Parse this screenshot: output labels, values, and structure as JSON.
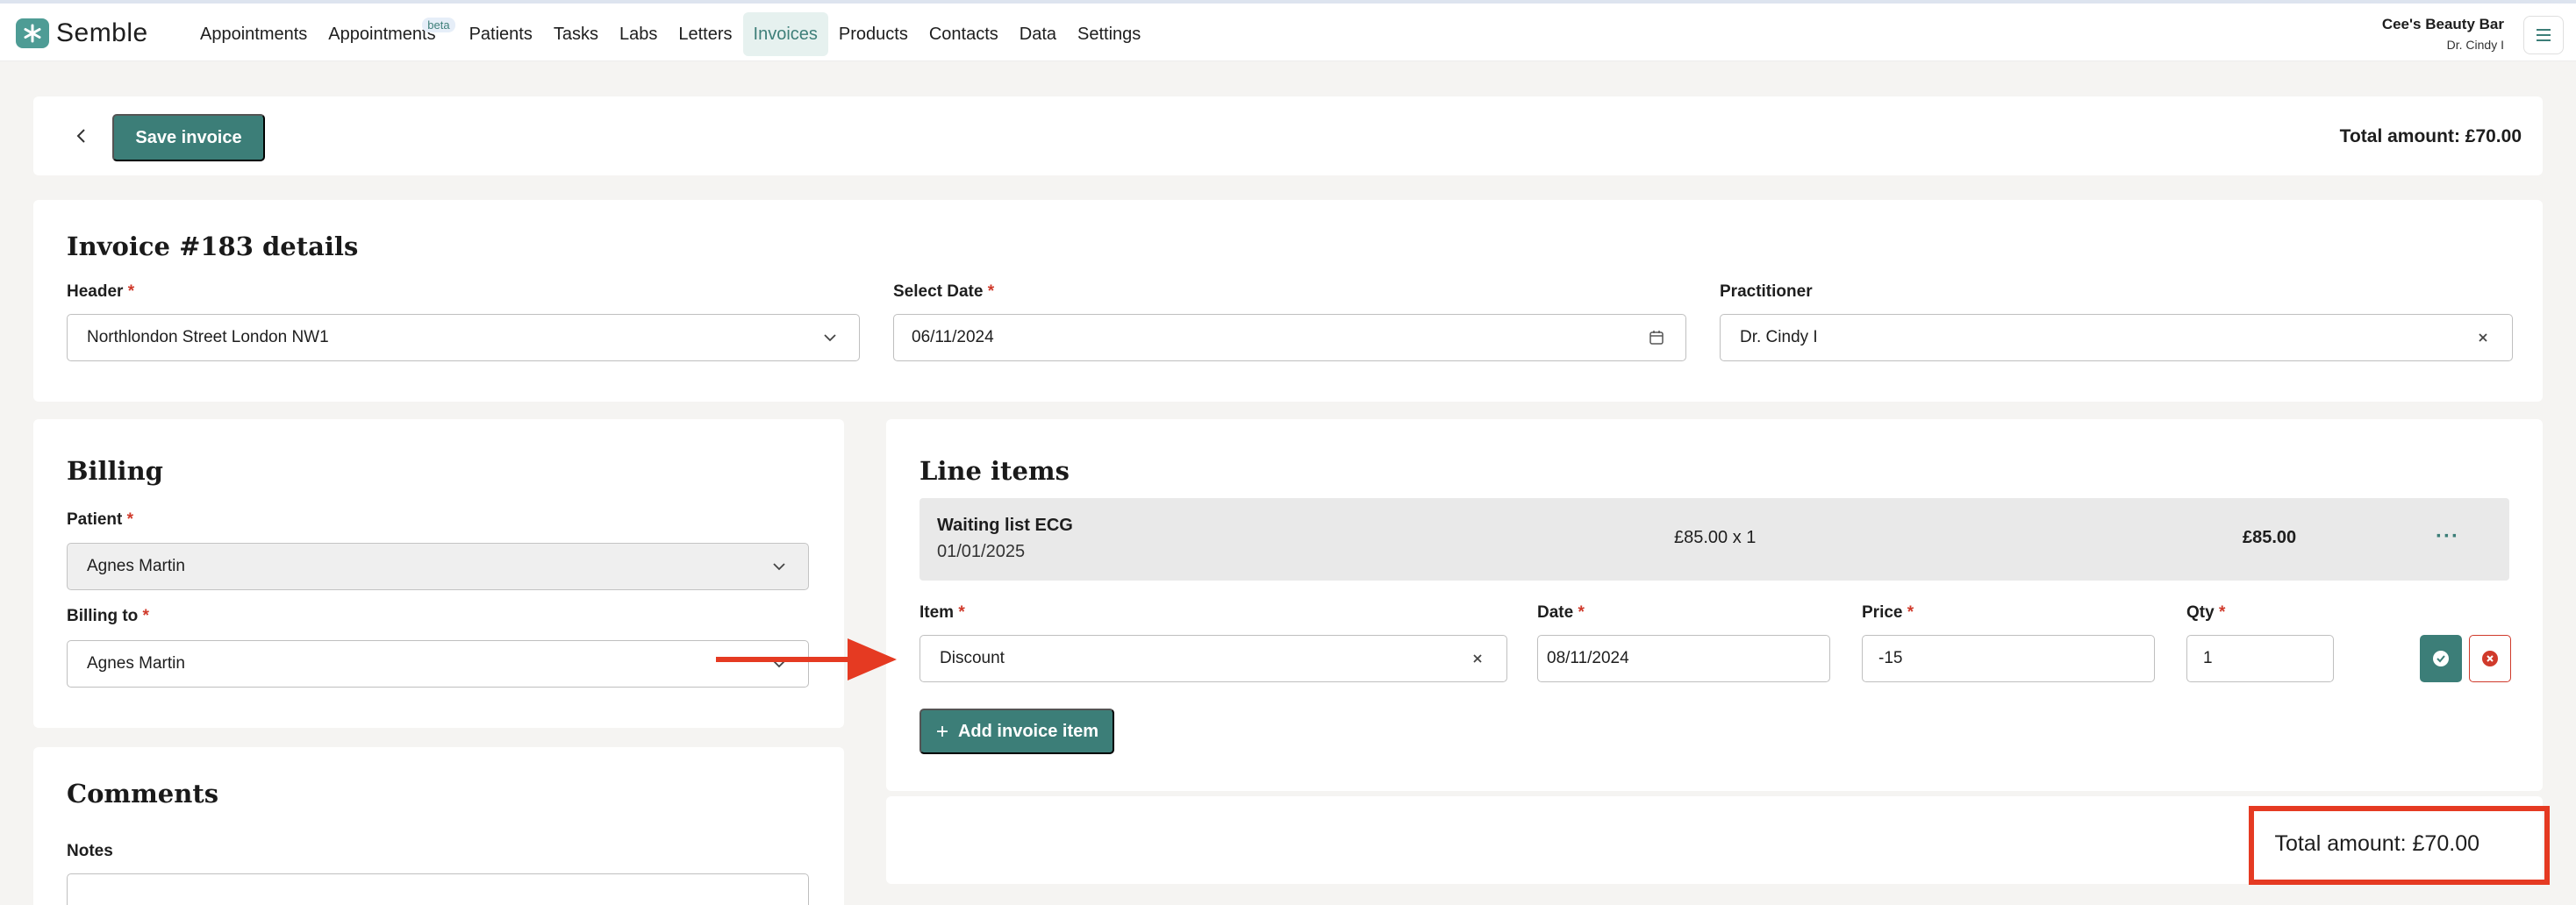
{
  "app": {
    "logo_text": "Semble",
    "brand_color": "#4e9c95",
    "accent_color": "#3c7e78",
    "annotation_color": "#e53a22"
  },
  "nav": {
    "items": [
      {
        "label": "Appointments"
      },
      {
        "label": "Appointments",
        "badge": "beta"
      },
      {
        "label": "Patients"
      },
      {
        "label": "Tasks"
      },
      {
        "label": "Labs"
      },
      {
        "label": "Letters"
      },
      {
        "label": "Invoices",
        "active": true
      },
      {
        "label": "Products"
      },
      {
        "label": "Contacts"
      },
      {
        "label": "Data"
      },
      {
        "label": "Settings"
      }
    ],
    "clinic_name": "Cee's Beauty Bar",
    "user_name": "Dr. Cindy I",
    "menu_icon": "hamburger-icon"
  },
  "toolbar": {
    "save_label": "Save invoice",
    "total_label": "Total amount: £70.00"
  },
  "details": {
    "title": "Invoice #183 details",
    "header_label": "Header",
    "header_value": "Northlondon Street London NW1",
    "date_label": "Select Date",
    "date_value": "06/11/2024",
    "practitioner_label": "Practitioner",
    "practitioner_value": "Dr. Cindy I"
  },
  "billing": {
    "title": "Billing",
    "patient_label": "Patient",
    "patient_value": "Agnes Martin",
    "billing_to_label": "Billing to",
    "billing_to_value": "Agnes Martin"
  },
  "comments": {
    "title": "Comments",
    "notes_label": "Notes"
  },
  "line_items": {
    "title": "Line items",
    "existing": {
      "name": "Waiting list ECG",
      "date": "01/01/2025",
      "price_qty": "£85.00 x 1",
      "total": "£85.00",
      "more": "···"
    },
    "new_item": {
      "item_label": "Item",
      "item_value": "Discount",
      "date_label": "Date",
      "date_value": "08/11/2024",
      "price_label": "Price",
      "price_value": "-15",
      "qty_label": "Qty",
      "qty_value": "1"
    },
    "add_label": "Add invoice item"
  },
  "footer": {
    "total_label": "Total amount: £70.00"
  }
}
